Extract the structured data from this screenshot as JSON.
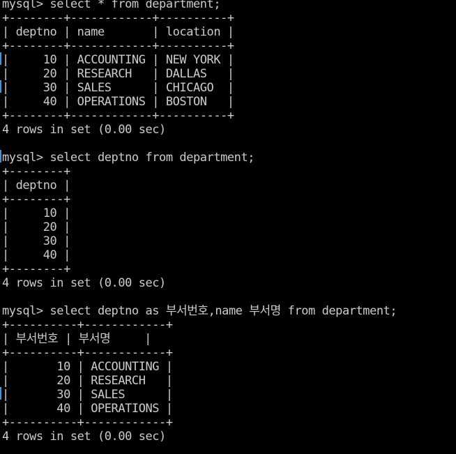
{
  "terminal": {
    "colors": {
      "background": "#000000",
      "foreground": "#cccccc",
      "margin_marker": "#3a96dd"
    },
    "lines": [
      "mysql> select * from department;",
      "+--------+------------+----------+",
      "| deptno | name       | location |",
      "+--------+------------+----------+",
      "|     10 | ACCOUNTING | NEW YORK |",
      "|     20 | RESEARCH   | DALLAS   |",
      "|     30 | SALES      | CHICAGO  |",
      "|     40 | OPERATIONS | BOSTON   |",
      "+--------+------------+----------+",
      "4 rows in set (0.00 sec)",
      "",
      "mysql> select deptno from department;",
      "+--------+",
      "| deptno |",
      "+--------+",
      "|     10 |",
      "|     20 |",
      "|     30 |",
      "|     40 |",
      "+--------+",
      "4 rows in set (0.00 sec)",
      "",
      "mysql> select deptno as 부서번호,name 부서명 from department;",
      "+----------+------------+",
      "| 부서번호 | 부서명     |",
      "+----------+------------+",
      "|       10 | ACCOUNTING |",
      "|       20 | RESEARCH   |",
      "|       30 | SALES      |",
      "|       40 | OPERATIONS |",
      "+----------+------------+",
      "4 rows in set (0.00 sec)"
    ]
  }
}
